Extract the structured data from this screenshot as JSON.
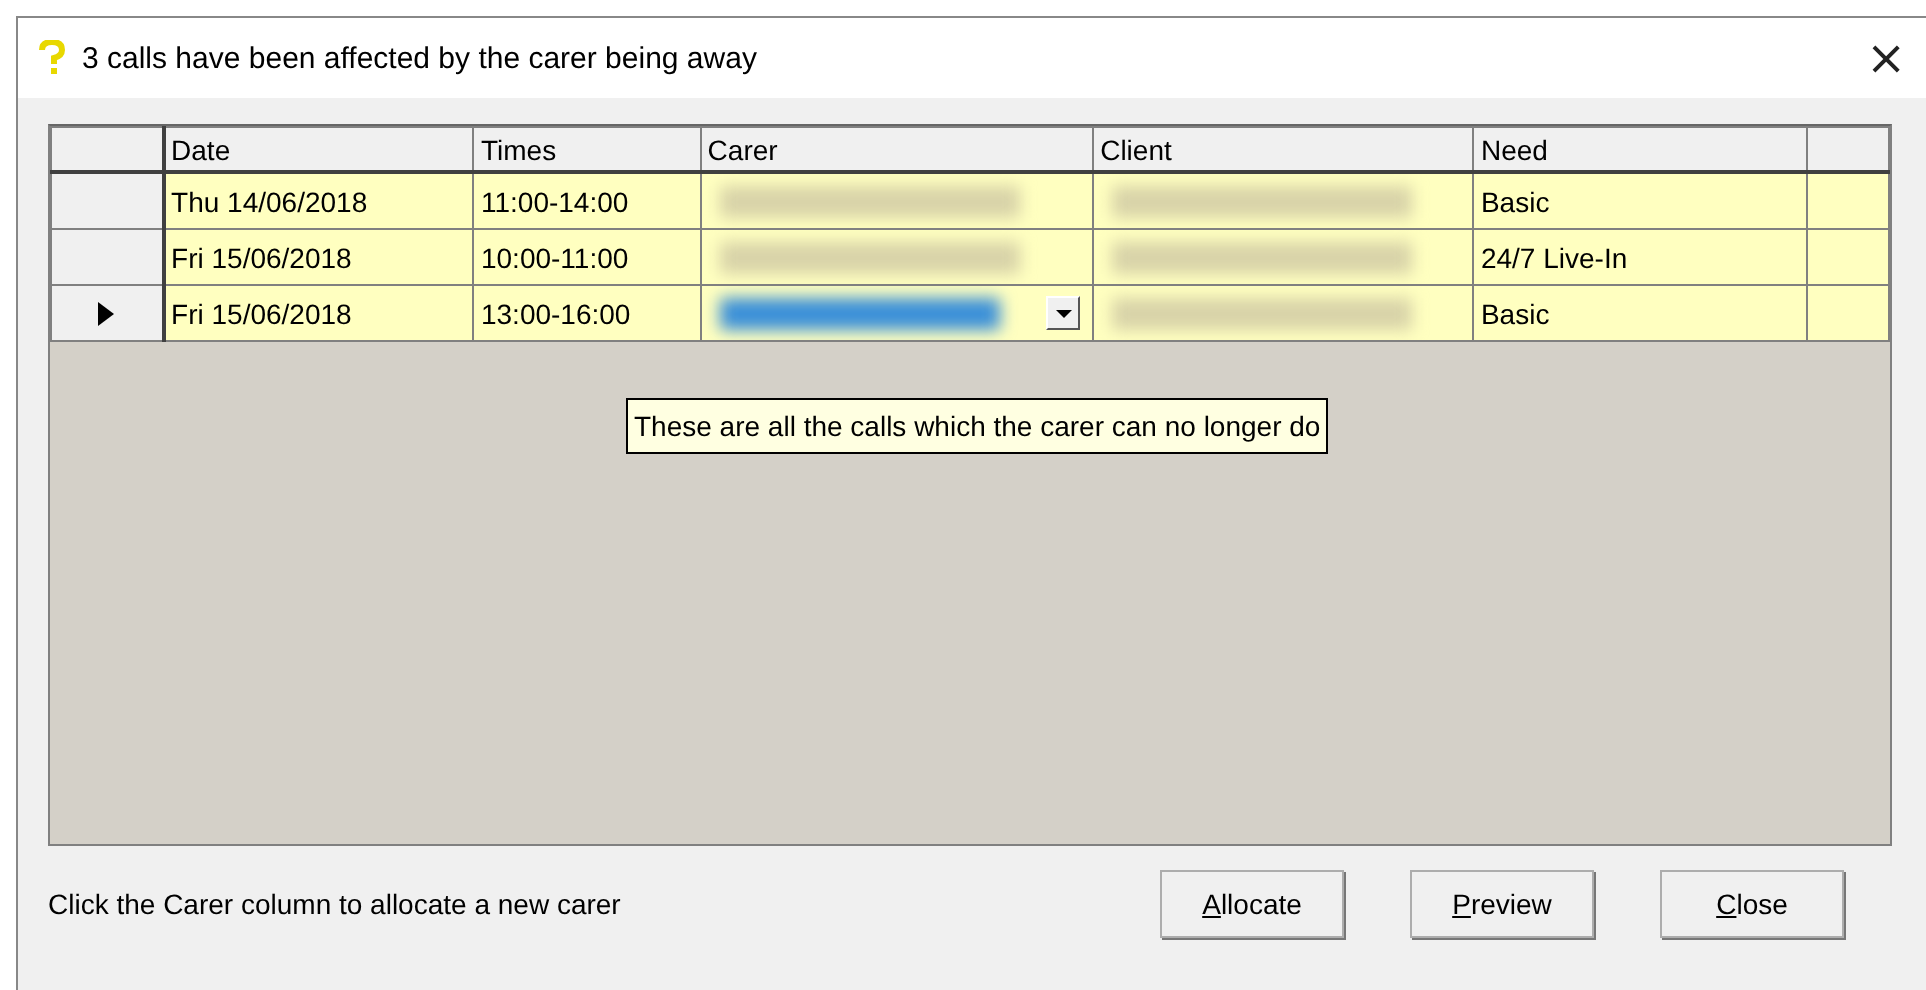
{
  "window": {
    "title": "3 calls have been affected by the carer being away",
    "close": "×"
  },
  "table": {
    "columns": [
      "Date",
      "Times",
      "Carer",
      "Client",
      "Need"
    ],
    "rows": [
      {
        "date": "Thu 14/06/2018",
        "times": "11:00-14:00",
        "need": "Basic",
        "selected": false
      },
      {
        "date": "Fri 15/06/2018",
        "times": "10:00-11:00",
        "need": "24/7 Live-In",
        "selected": false
      },
      {
        "date": "Fri 15/06/2018",
        "times": "13:00-16:00",
        "need": "Basic",
        "selected": true
      }
    ]
  },
  "tooltip": "These are all the calls which the carer can no longer do",
  "status": "Click the Carer column to allocate a new carer",
  "buttons": [
    "Allocate",
    "Preview",
    "Close"
  ]
}
